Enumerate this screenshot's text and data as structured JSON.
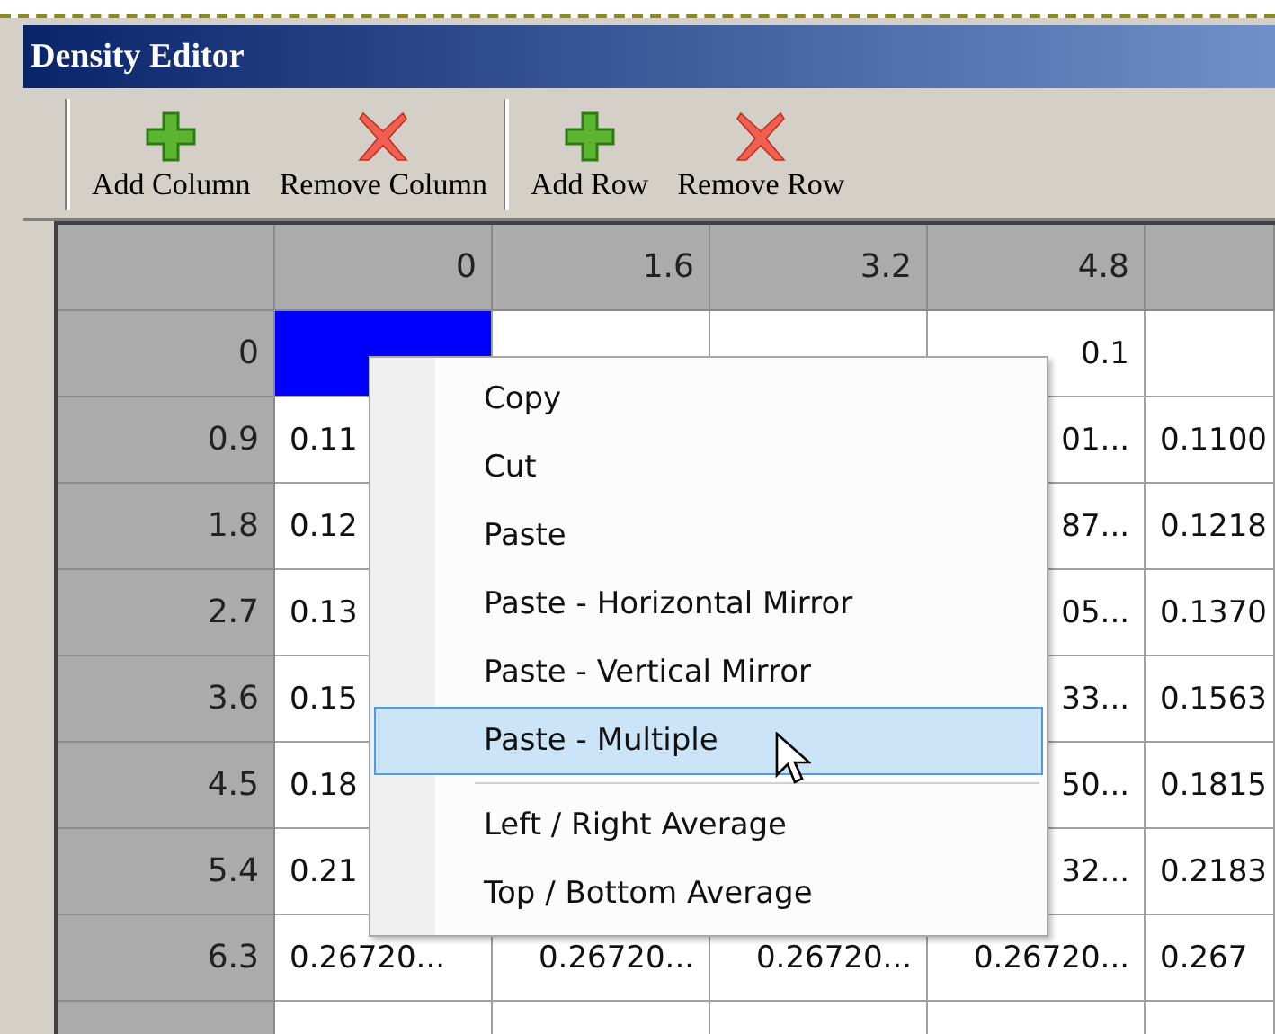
{
  "window": {
    "title": "Density Editor"
  },
  "toolbar": {
    "groups": [
      [
        {
          "label": "Add Column",
          "kind": "add"
        },
        {
          "label": "Remove Column",
          "kind": "remove"
        }
      ],
      [
        {
          "label": "Add Row",
          "kind": "add"
        },
        {
          "label": "Remove Row",
          "kind": "remove"
        }
      ]
    ]
  },
  "table": {
    "columns": [
      "0",
      "1.6",
      "3.2",
      "4.8",
      null
    ],
    "rows": [
      {
        "header": "0",
        "cells": [
          {
            "text": null,
            "selected": true
          },
          {
            "text": null,
            "selected": false
          },
          {
            "text": null,
            "selected": false
          },
          {
            "text": "0.1",
            "selected": false
          },
          {
            "text": null,
            "selected": false
          }
        ]
      },
      {
        "header": "0.9",
        "cells": [
          {
            "text": "0.11",
            "selected": false
          },
          null,
          null,
          {
            "text": "01...",
            "selected": false
          },
          {
            "text": "0.1100",
            "selected": false
          }
        ]
      },
      {
        "header": "1.8",
        "cells": [
          {
            "text": "0.12",
            "selected": false
          },
          null,
          null,
          {
            "text": "87...",
            "selected": false
          },
          {
            "text": "0.1218",
            "selected": false
          }
        ]
      },
      {
        "header": "2.7",
        "cells": [
          {
            "text": "0.13",
            "selected": false
          },
          null,
          null,
          {
            "text": "05...",
            "selected": false
          },
          {
            "text": "0.1370",
            "selected": false
          }
        ]
      },
      {
        "header": "3.6",
        "cells": [
          {
            "text": "0.15",
            "selected": false
          },
          null,
          null,
          {
            "text": "33...",
            "selected": false
          },
          {
            "text": "0.1563",
            "selected": false
          }
        ]
      },
      {
        "header": "4.5",
        "cells": [
          {
            "text": "0.18",
            "selected": false
          },
          null,
          null,
          {
            "text": "50...",
            "selected": false
          },
          {
            "text": "0.1815",
            "selected": false
          }
        ]
      },
      {
        "header": "5.4",
        "cells": [
          {
            "text": "0.21",
            "selected": false
          },
          null,
          null,
          {
            "text": "32...",
            "selected": false
          },
          {
            "text": "0.2183",
            "selected": false
          }
        ]
      },
      {
        "header": "6.3",
        "cells": [
          {
            "text": "0.26720...",
            "selected": false
          },
          {
            "text": "0.26720...",
            "selected": false
          },
          {
            "text": "0.26720...",
            "selected": false
          },
          {
            "text": "0.26720...",
            "selected": false
          },
          {
            "text": "0.267",
            "selected": false
          }
        ]
      }
    ]
  },
  "context_menu": {
    "items": [
      {
        "kind": "item",
        "label": "Copy",
        "selected": false
      },
      {
        "kind": "item",
        "label": "Cut",
        "selected": false
      },
      {
        "kind": "item",
        "label": "Paste",
        "selected": false
      },
      {
        "kind": "item",
        "label": "Paste - Horizontal Mirror",
        "selected": false
      },
      {
        "kind": "item",
        "label": "Paste - Vertical Mirror",
        "selected": false
      },
      {
        "kind": "item",
        "label": "Paste - Multiple",
        "selected": true
      },
      {
        "kind": "separator"
      },
      {
        "kind": "item",
        "label": "Left / Right Average",
        "selected": false
      },
      {
        "kind": "item",
        "label": "Top / Bottom Average",
        "selected": false
      }
    ]
  }
}
